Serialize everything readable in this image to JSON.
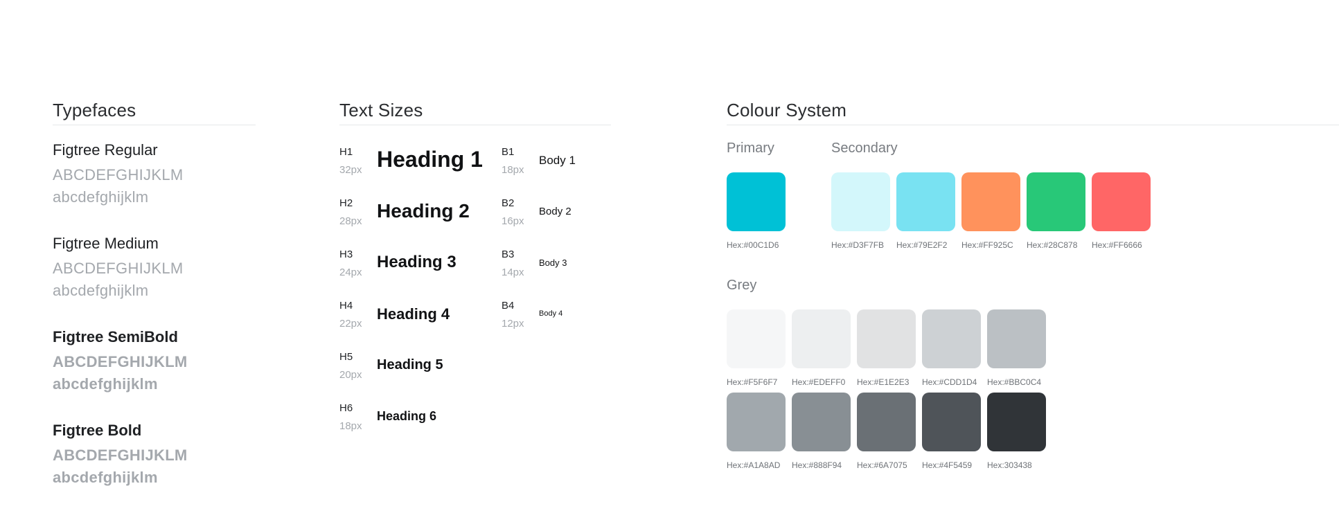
{
  "typefaces": {
    "title": "Typefaces",
    "fonts": [
      {
        "name": "Figtree Regular",
        "upper": "ABCDEFGHIJKLM",
        "lower": "abcdefghijklm"
      },
      {
        "name": "Figtree Medium",
        "upper": "ABCDEFGHIJKLM",
        "lower": "abcdefghijklm"
      },
      {
        "name": "Figtree SemiBold",
        "upper": "ABCDEFGHIJKLM",
        "lower": "abcdefghijklm"
      },
      {
        "name": "Figtree Bold",
        "upper": "ABCDEFGHIJKLM",
        "lower": "abcdefghijklm"
      }
    ]
  },
  "text_sizes": {
    "title": "Text Sizes",
    "headings": [
      {
        "code": "H1",
        "size": "32px",
        "label": "Heading 1"
      },
      {
        "code": "H2",
        "size": "28px",
        "label": "Heading 2"
      },
      {
        "code": "H3",
        "size": "24px",
        "label": "Heading 3"
      },
      {
        "code": "H4",
        "size": "22px",
        "label": "Heading 4"
      },
      {
        "code": "H5",
        "size": "20px",
        "label": "Heading 5"
      },
      {
        "code": "H6",
        "size": "18px",
        "label": "Heading 6"
      }
    ],
    "body": [
      {
        "code": "B1",
        "size": "18px",
        "label": "Body 1"
      },
      {
        "code": "B2",
        "size": "16px",
        "label": "Body 2"
      },
      {
        "code": "B3",
        "size": "14px",
        "label": "Body 3"
      },
      {
        "code": "B4",
        "size": "12px",
        "label": "Body 4"
      }
    ]
  },
  "colour_system": {
    "title": "Colour System",
    "primary": {
      "title": "Primary",
      "swatches": [
        {
          "color": "#00C1D6",
          "label": "Hex:#00C1D6"
        }
      ]
    },
    "secondary": {
      "title": "Secondary",
      "swatches": [
        {
          "color": "#D3F7FB",
          "label": "Hex:#D3F7FB"
        },
        {
          "color": "#79E2F2",
          "label": "Hex:#79E2F2"
        },
        {
          "color": "#FF925C",
          "label": "Hex:#FF925C"
        },
        {
          "color": "#28C878",
          "label": "Hex:#28C878"
        },
        {
          "color": "#FF6666",
          "label": "Hex:#FF6666"
        }
      ]
    },
    "grey": {
      "title": "Grey",
      "swatches": [
        {
          "color": "#F5F6F7",
          "label": "Hex:#F5F6F7"
        },
        {
          "color": "#EDEFF0",
          "label": "Hex:#EDEFF0"
        },
        {
          "color": "#E1E2E3",
          "label": "Hex:#E1E2E3"
        },
        {
          "color": "#CDD1D4",
          "label": "Hex:#CDD1D4"
        },
        {
          "color": "#BBC0C4",
          "label": "Hex:#BBC0C4"
        },
        {
          "color": "#A1A8AD",
          "label": "Hex:#A1A8AD"
        },
        {
          "color": "#888F94",
          "label": "Hex:#888F94"
        },
        {
          "color": "#6A7075",
          "label": "Hex:#6A7075"
        },
        {
          "color": "#4F5459",
          "label": "Hex:#4F5459"
        },
        {
          "color": "#303438",
          "label": "Hex:303438"
        }
      ]
    }
  }
}
